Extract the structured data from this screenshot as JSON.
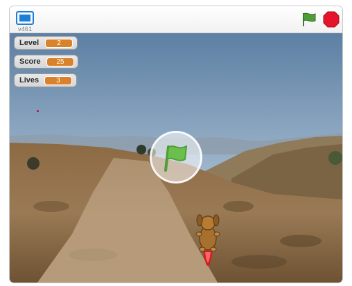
{
  "toolbar": {
    "version": "v461",
    "fullscreen_icon": "fullscreen-icon",
    "green_flag_icon": "green-flag-icon",
    "stop_icon": "stop-sign-icon"
  },
  "monitors": [
    {
      "label": "Level",
      "value": "2"
    },
    {
      "label": "Score",
      "value": "25"
    },
    {
      "label": "Lives",
      "value": "3"
    }
  ],
  "colors": {
    "monitor_value_bg": "#d9822b",
    "green_flag": "#4c9f38",
    "stop_button": "#e5142a",
    "fullscreen_icon": "#1c7fd8"
  },
  "stage": {
    "start_overlay_icon": "green-flag-icon",
    "player_sprite": "dog-on-rocket"
  }
}
